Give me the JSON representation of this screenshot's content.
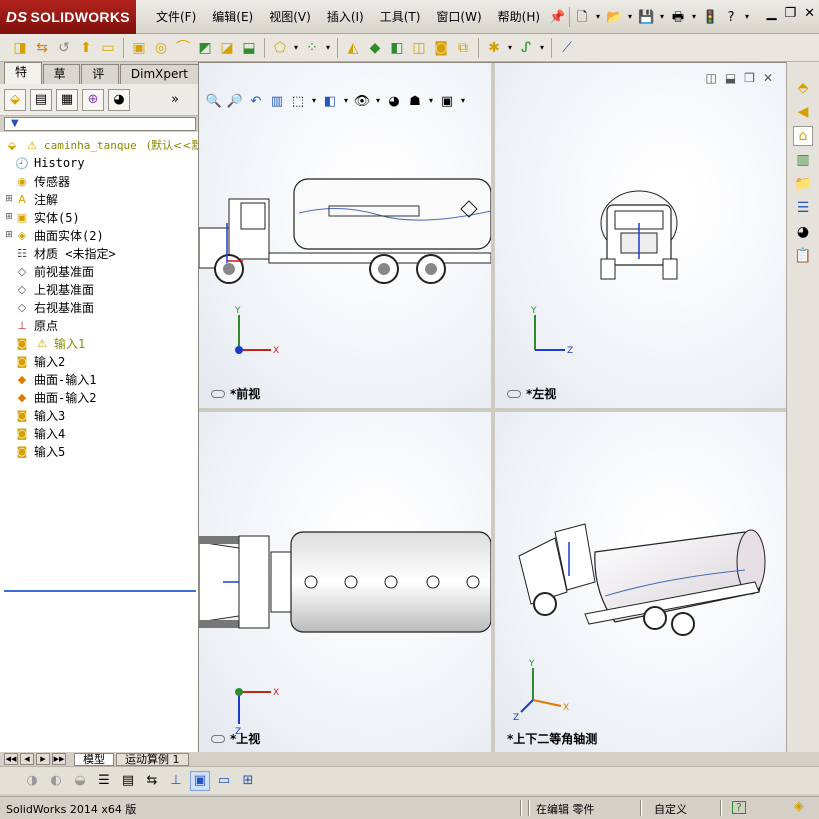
{
  "app": {
    "brand_prefix": "DS",
    "brand": "SOLIDWORKS"
  },
  "menu": [
    "文件(F)",
    "编辑(E)",
    "视图(V)",
    "插入(I)",
    "工具(T)",
    "窗口(W)",
    "帮助(H)"
  ],
  "panel_tabs": [
    "特征",
    "草图",
    "评估",
    "DimXpert"
  ],
  "tree": {
    "root_label": "caminha_tanque",
    "root_config": "(默认<<默认",
    "items": [
      {
        "label": "History",
        "icon": "history-icon",
        "expandable": false
      },
      {
        "label": "传感器",
        "icon": "sensor-icon",
        "expandable": false
      },
      {
        "label": "注解",
        "icon": "annotation-icon",
        "expandable": true
      },
      {
        "label": "实体(5)",
        "icon": "solid-bodies-icon",
        "expandable": true
      },
      {
        "label": "曲面实体(2)",
        "icon": "surface-bodies-icon",
        "expandable": true
      },
      {
        "label": "材质 <未指定>",
        "icon": "material-icon",
        "expandable": false
      },
      {
        "label": "前视基准面",
        "icon": "plane-icon",
        "expandable": false
      },
      {
        "label": "上视基准面",
        "icon": "plane-icon",
        "expandable": false
      },
      {
        "label": "右视基准面",
        "icon": "plane-icon",
        "expandable": false
      },
      {
        "label": "原点",
        "icon": "origin-icon",
        "expandable": false
      },
      {
        "label": "输入1",
        "icon": "import-warning-icon",
        "expandable": false
      },
      {
        "label": "输入2",
        "icon": "import-icon",
        "expandable": false
      },
      {
        "label": "曲面-输入1",
        "icon": "surface-import-icon",
        "expandable": false
      },
      {
        "label": "曲面-输入2",
        "icon": "surface-import-icon",
        "expandable": false
      },
      {
        "label": "输入3",
        "icon": "import-icon",
        "expandable": false
      },
      {
        "label": "输入4",
        "icon": "import-icon",
        "expandable": false
      },
      {
        "label": "输入5",
        "icon": "import-icon",
        "expandable": false
      }
    ]
  },
  "viewports": [
    {
      "name": "前视",
      "axes": [
        "Y",
        "X"
      ]
    },
    {
      "name": "左视",
      "axes": [
        "Y",
        "Z"
      ]
    },
    {
      "name": "上视",
      "axes": [
        "X",
        "Z"
      ]
    },
    {
      "name": "上下二等角轴测",
      "axes": [
        "Y",
        "X",
        "Z"
      ]
    }
  ],
  "bottom_tabs": [
    "模型",
    "运动算例 1"
  ],
  "status": {
    "version": "SolidWorks 2014 x64 版",
    "mode": "在编辑 零件",
    "units": "自定义",
    "help": "?"
  }
}
